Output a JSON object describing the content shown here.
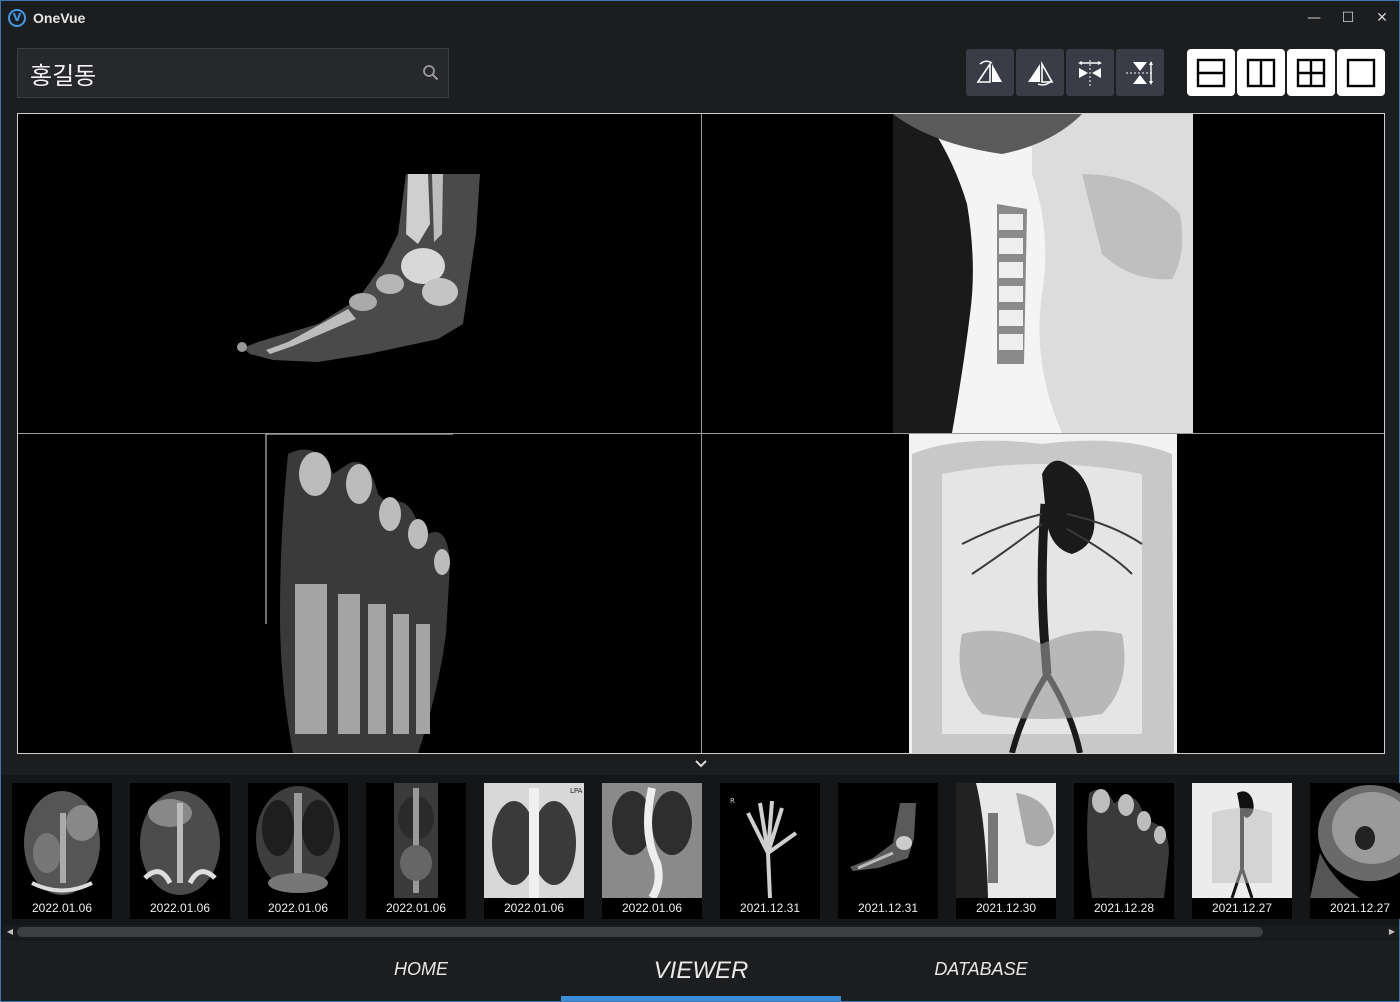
{
  "app": {
    "title": "OneVue",
    "logo_letter": "V",
    "accent_color": "#3a8fd6"
  },
  "window_controls": {
    "minimize": "—",
    "maximize": "☐",
    "close": "✕"
  },
  "search": {
    "value": "홍길동"
  },
  "tools": [
    "flip-vertical-icon",
    "flip-horizontal-icon",
    "flip-arrows-horizontal-icon",
    "flip-arrows-vertical-icon"
  ],
  "layouts": [
    "layout-2-rows-icon",
    "layout-2-columns-icon",
    "layout-2x2-icon",
    "layout-1x1-icon"
  ],
  "thumbnails": [
    {
      "date": "2022.01.06"
    },
    {
      "date": "2022.01.06"
    },
    {
      "date": "2022.01.06"
    },
    {
      "date": "2022.01.06"
    },
    {
      "date": "2022.01.06"
    },
    {
      "date": "2022.01.06"
    },
    {
      "date": "2021.12.31"
    },
    {
      "date": "2021.12.31"
    },
    {
      "date": "2021.12.30"
    },
    {
      "date": "2021.12.28"
    },
    {
      "date": "2021.12.27"
    },
    {
      "date": "2021.12.27"
    }
  ],
  "nav": {
    "home": "HOME",
    "viewer": "VIEWER",
    "database": "DATABASE",
    "active": "VIEWER"
  }
}
